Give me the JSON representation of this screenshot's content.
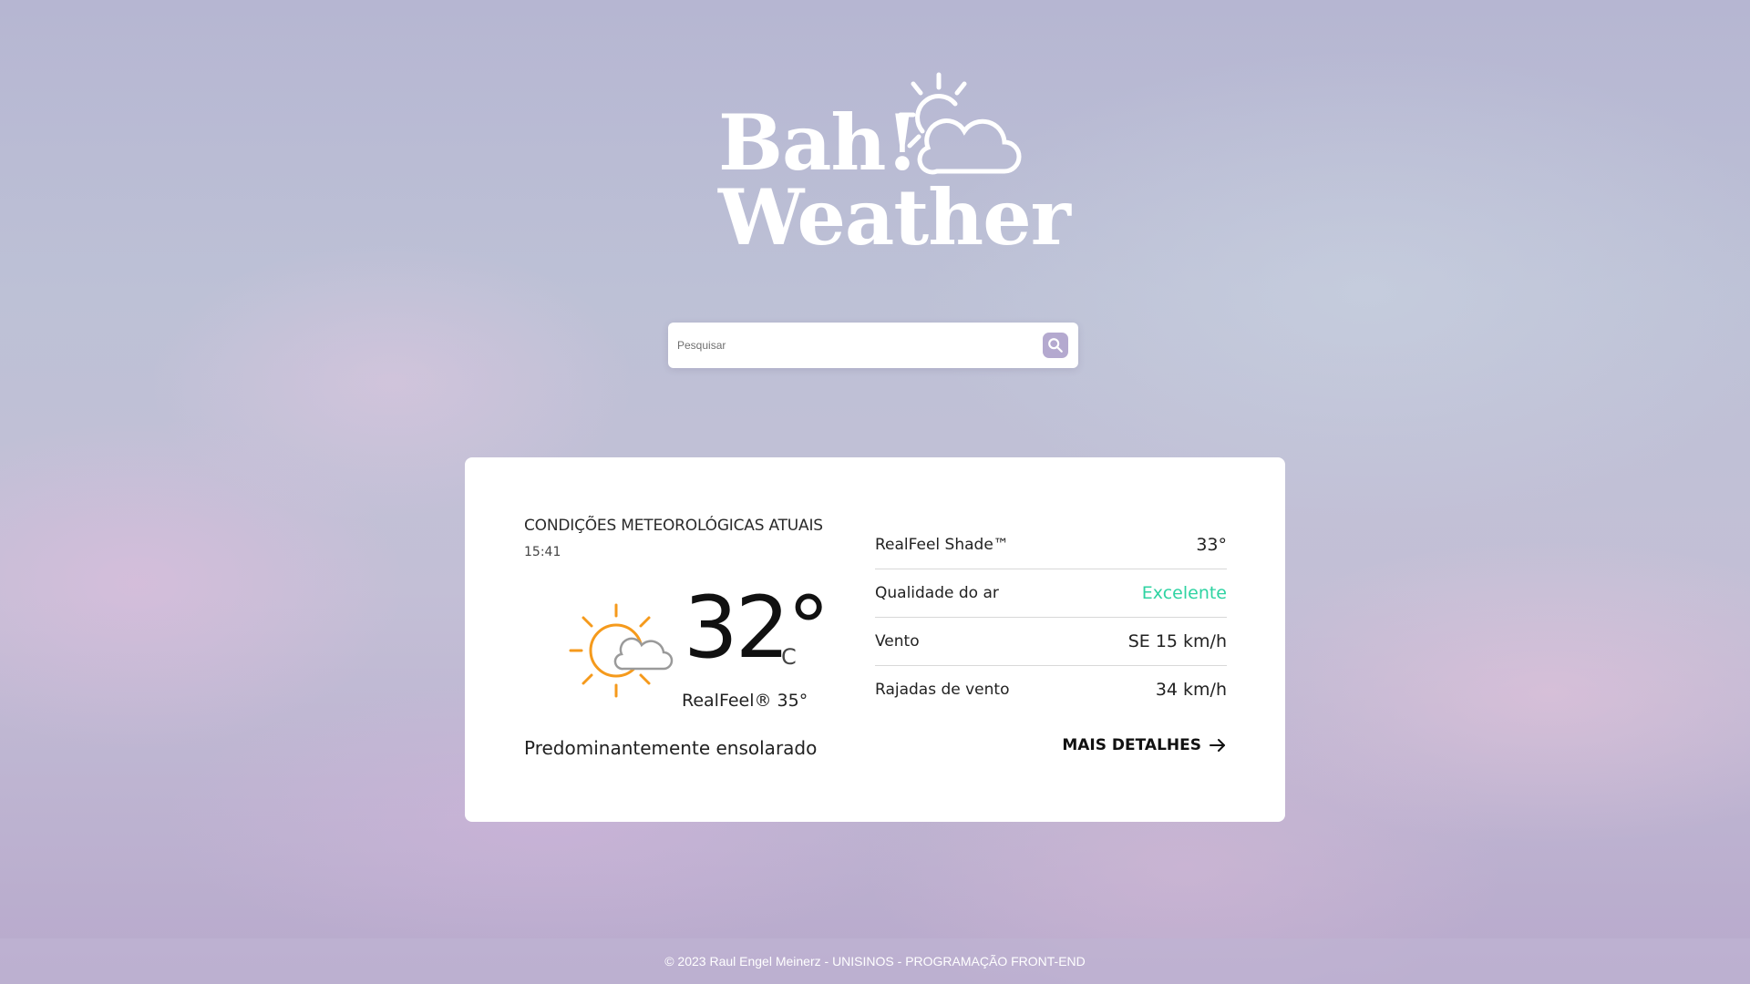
{
  "logo": {
    "line1": "Bah!",
    "line2": "Weather",
    "icon": "sun-cloud-icon"
  },
  "search": {
    "placeholder": "Pesquisar",
    "value": "",
    "icon": "search-icon"
  },
  "current": {
    "heading": "CONDIÇÕES METEOROLÓGICAS ATUAIS",
    "time": "15:41",
    "icon": "mostly-sunny-icon",
    "temperature": "32°",
    "unit": "C",
    "realfeel": "RealFeel® 35°",
    "condition": "Predominantemente ensolarado"
  },
  "details": [
    {
      "label": "RealFeel Shade™",
      "value": "33°"
    },
    {
      "label": "Qualidade do ar",
      "value": "Excelente",
      "color": "#2ed3a2"
    },
    {
      "label": "Vento",
      "value": "SE 15 km/h"
    },
    {
      "label": "Rajadas de vento",
      "value": "34 km/h"
    }
  ],
  "more_link": {
    "label": "MAIS DETALHES",
    "icon": "arrow-right-icon"
  },
  "footer": {
    "text": "© 2023 Raul Engel Meinerz - UNISINOS - PROGRAMAÇÃO FRONT-END"
  },
  "colors": {
    "accent": "#b4a9cf",
    "good_status": "#2ed3a2",
    "sun": "#f59a1c",
    "card": "#ffffff"
  }
}
